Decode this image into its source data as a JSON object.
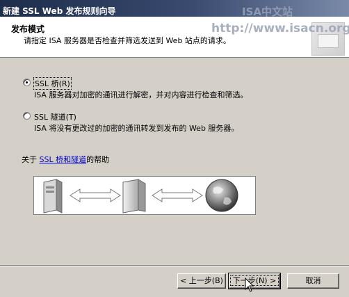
{
  "window": {
    "title": "新建 SSL Web 发布规则向导"
  },
  "watermark": {
    "line1": "ISA中文站",
    "line2": "http://www.isacn.org"
  },
  "header": {
    "title": "发布模式",
    "description": "请指定 ISA 服务器是否检查并筛选发送到 Web 站点的请求。"
  },
  "options": [
    {
      "label": "SSL 桥(R)",
      "description": "ISA 服务器对加密的通讯进行解密，并对内容进行检查和筛选。",
      "selected": true
    },
    {
      "label": "SSL 隧道(T)",
      "description": "ISA 将没有更改过的加密的通讯转发到发布的 Web 服务器。",
      "selected": false
    }
  ],
  "help": {
    "prefix": "关于 ",
    "link": "SSL 桥和隧道",
    "suffix": "的帮助"
  },
  "diagram": {
    "icons": [
      "client-computer-icon",
      "isa-server-icon",
      "internet-globe-icon"
    ]
  },
  "buttons": {
    "back": "< 上一步(B)",
    "next": "下一步(N) >",
    "cancel": "取消"
  }
}
